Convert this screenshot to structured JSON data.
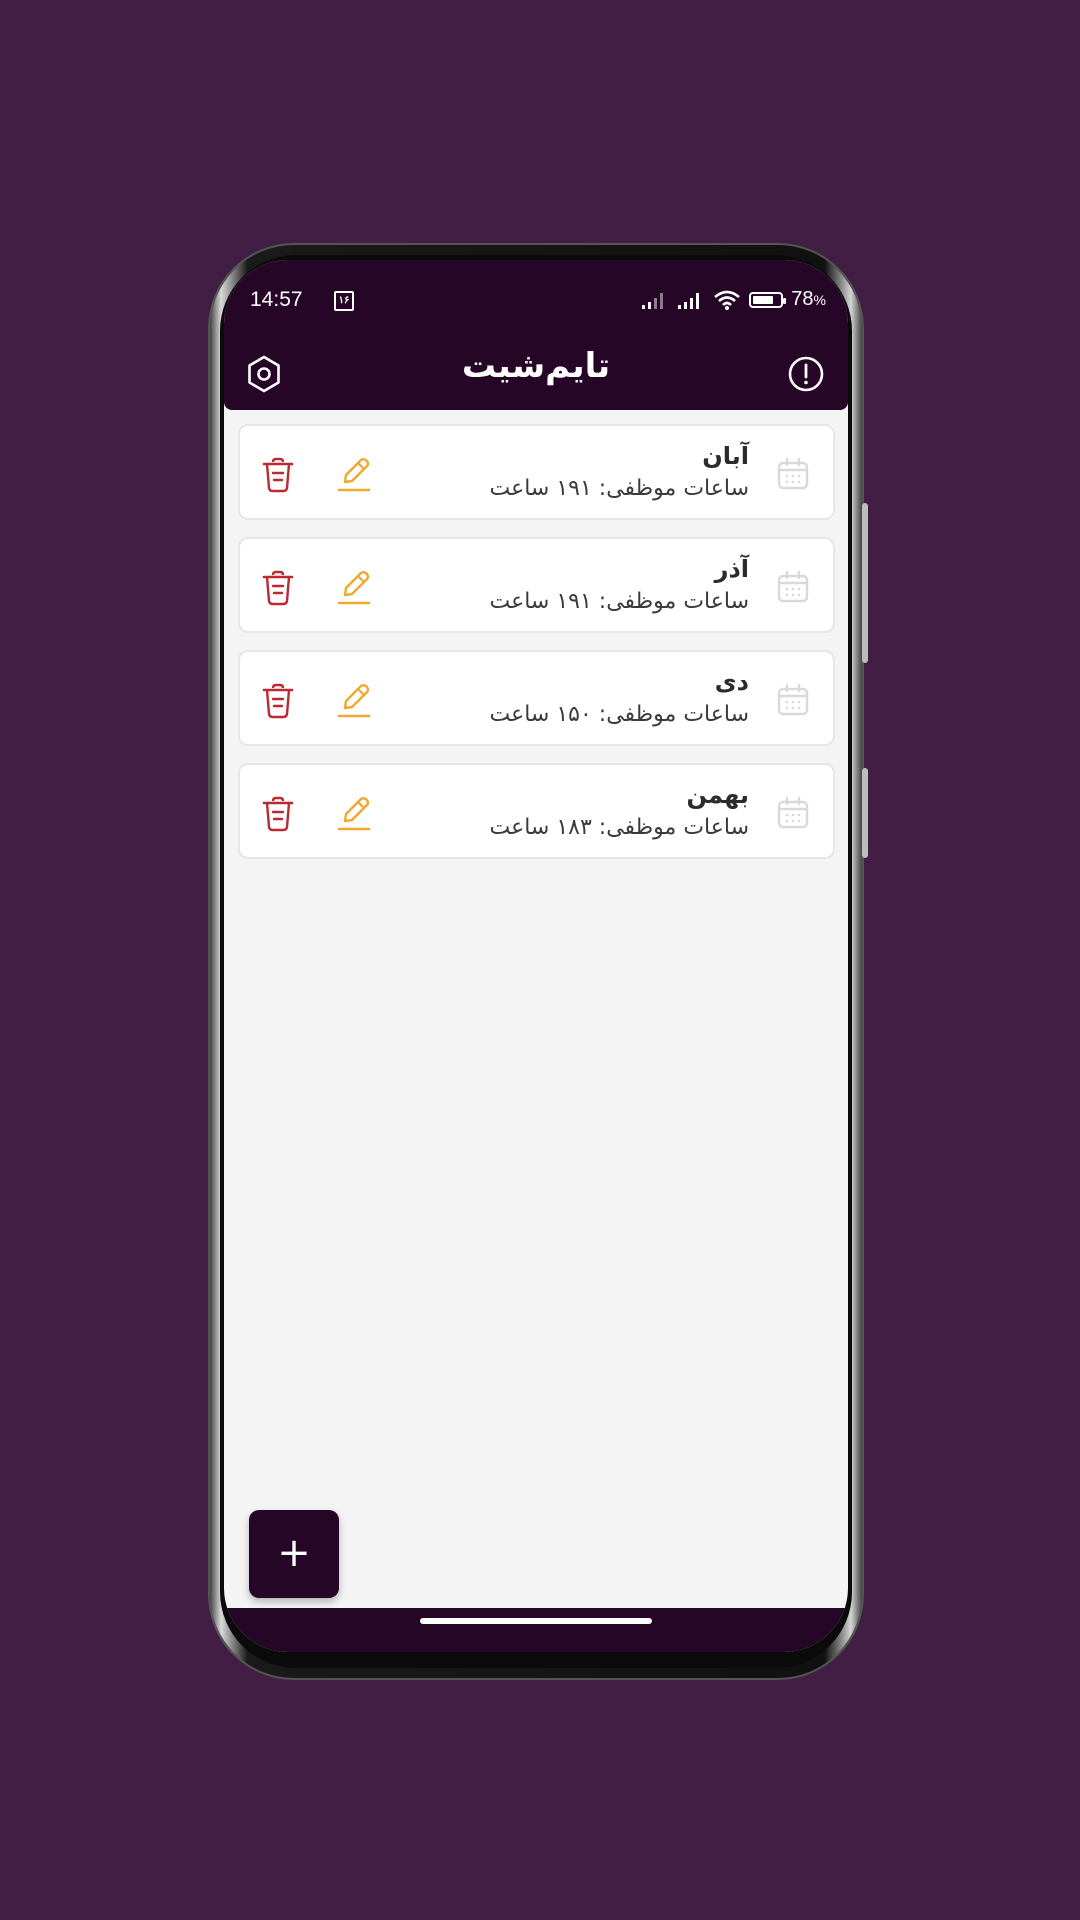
{
  "status_bar": {
    "time": "14:57",
    "date_badge": "۱۶",
    "battery_percent": 78,
    "battery_text": "78",
    "battery_unit": "%"
  },
  "app_bar": {
    "title": "تایم‌شیت",
    "settings_icon": "settings-hex-icon",
    "info_icon": "info-icon"
  },
  "months": [
    {
      "name": "آبان",
      "hours": "ساعات موظفی: ۱۹۱ ساعت"
    },
    {
      "name": "آذر",
      "hours": "ساعات موظفی: ۱۹۱ ساعت"
    },
    {
      "name": "دی",
      "hours": "ساعات موظفی: ۱۵۰ ساعت"
    },
    {
      "name": "بهمن",
      "hours": "ساعات موظفی: ۱۸۳ ساعت"
    }
  ],
  "fab": {
    "label": "+"
  },
  "colors": {
    "background": "#421d44",
    "app_bar": "#260626",
    "edit": "#f0a830",
    "delete": "#c0282f",
    "calendar": "#d9d9d9"
  }
}
